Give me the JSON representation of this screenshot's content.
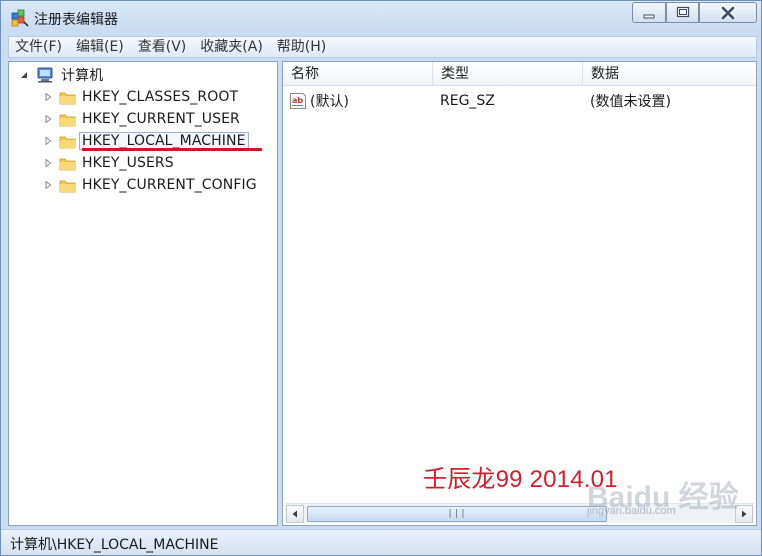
{
  "window": {
    "title": "注册表编辑器"
  },
  "menu": [
    "文件(F)",
    "编辑(E)",
    "查看(V)",
    "收藏夹(A)",
    "帮助(H)"
  ],
  "tree": {
    "root": "计算机",
    "items": [
      {
        "label": "HKEY_CLASSES_ROOT",
        "selected": false
      },
      {
        "label": "HKEY_CURRENT_USER",
        "selected": false
      },
      {
        "label": "HKEY_LOCAL_MACHINE",
        "selected": true
      },
      {
        "label": "HKEY_USERS",
        "selected": false
      },
      {
        "label": "HKEY_CURRENT_CONFIG",
        "selected": false
      }
    ]
  },
  "list": {
    "columns": [
      "名称",
      "类型",
      "数据"
    ],
    "rows": [
      {
        "name": "(默认)",
        "type": "REG_SZ",
        "data": "(数值未设置)"
      }
    ]
  },
  "watermark": "壬辰龙99 2014.01",
  "status": "计算机\\HKEY_LOCAL_MACHINE",
  "baidu": {
    "logo_text": "Baidu 经验",
    "url": "jingyan.baidu.com"
  },
  "colors": {
    "accent_red": "#d21f2b",
    "underline_red": "#d8112a",
    "folder_yellow": "#f4c84b",
    "frame_blue": "#c9dcf2"
  }
}
